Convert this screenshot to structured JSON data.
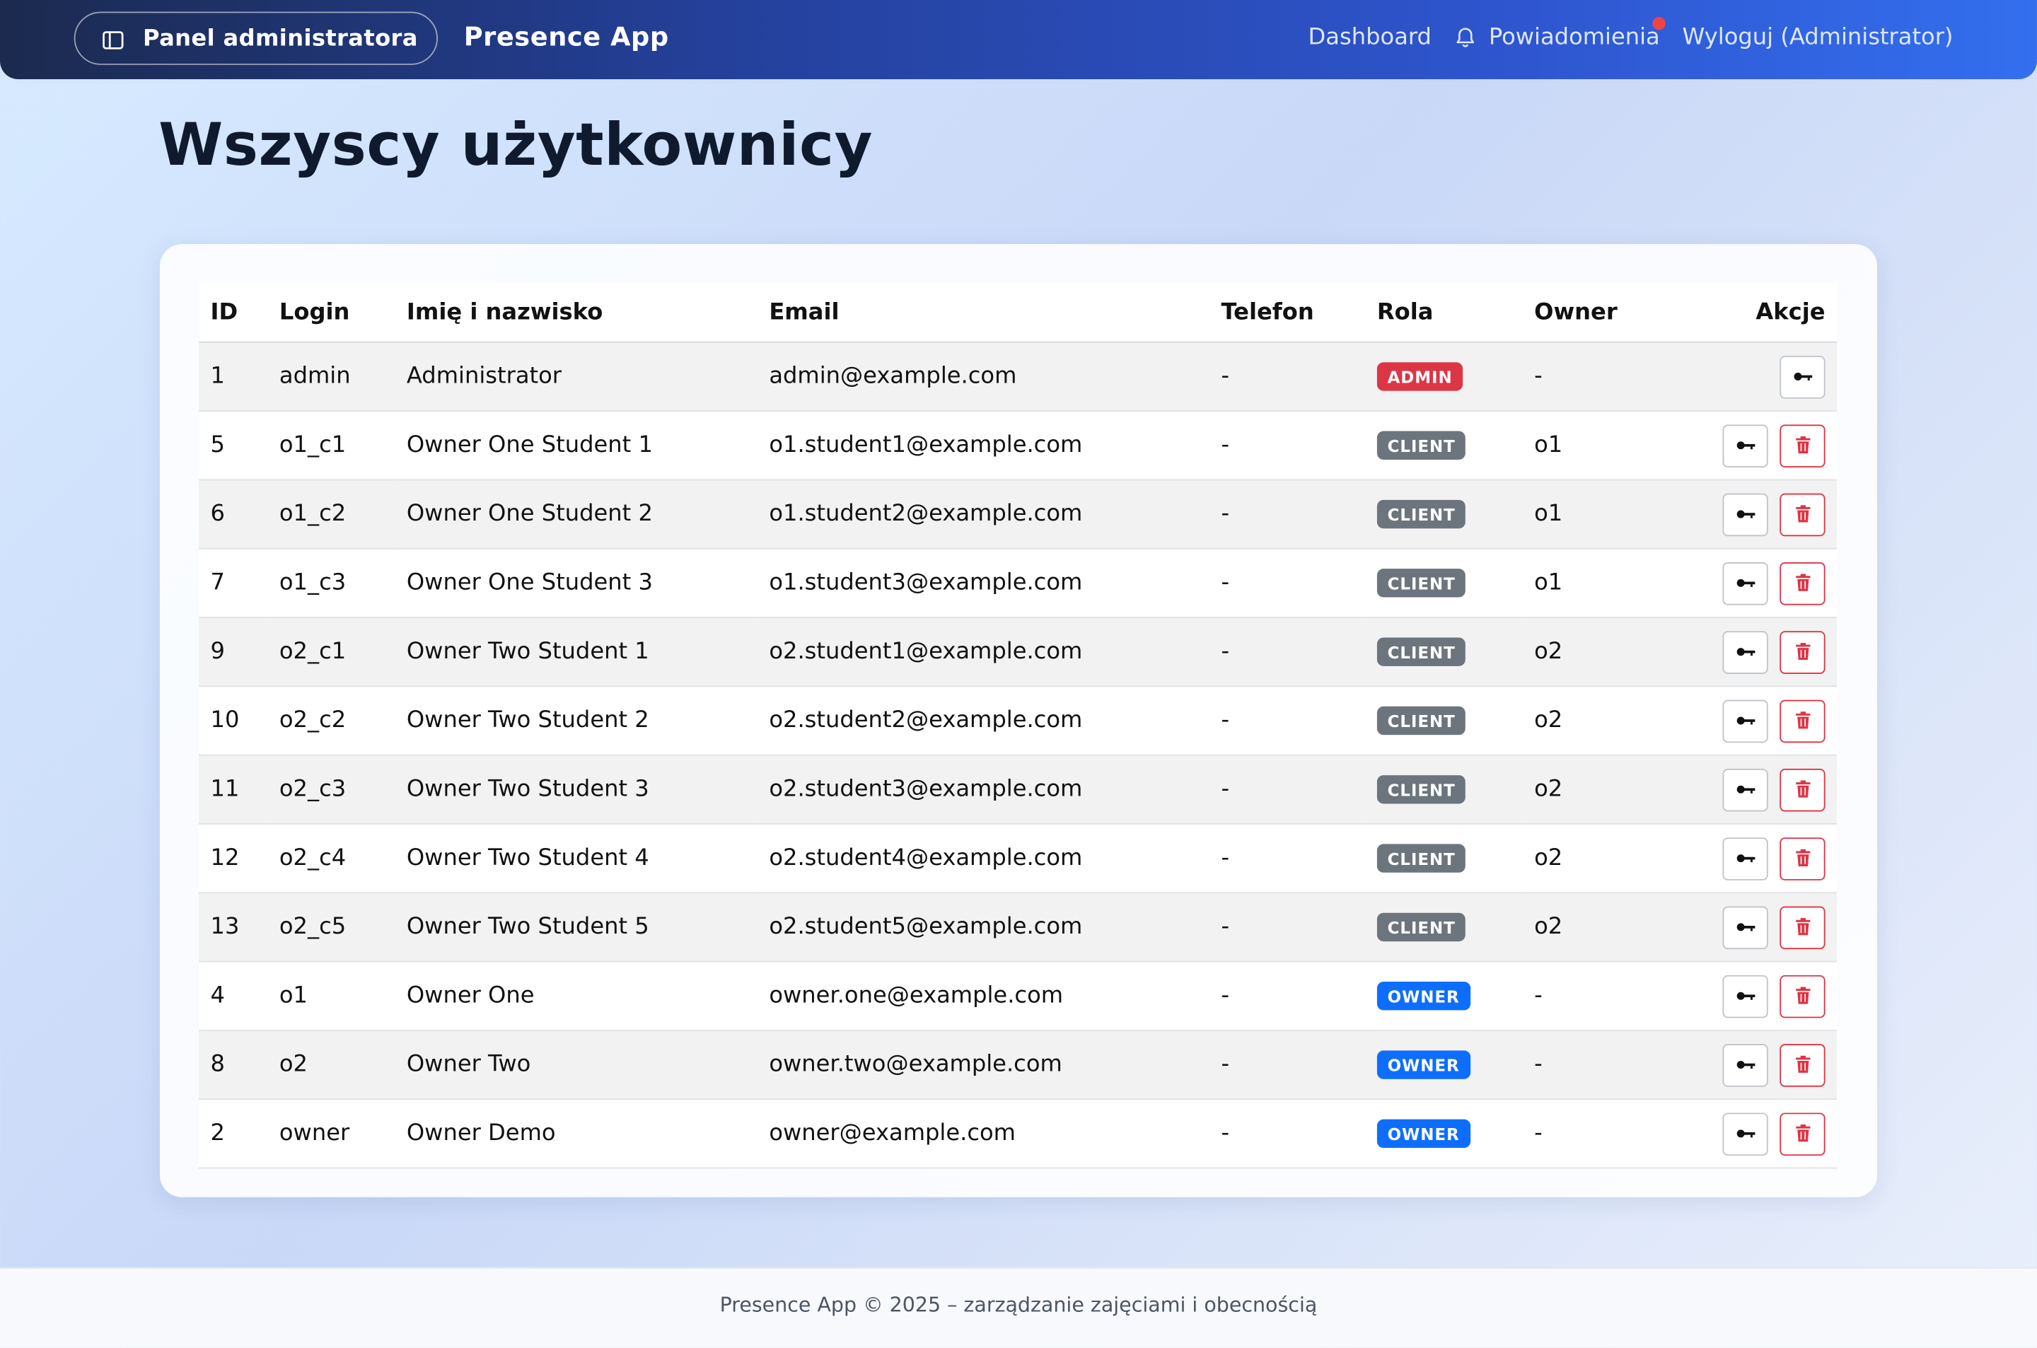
{
  "app": {
    "brand": "Presence App"
  },
  "topbar": {
    "panel_label": "Panel administratora",
    "nav": {
      "dashboard": "Dashboard",
      "notifications": "Powiadomienia",
      "logout": "Wyloguj (Administrator)"
    }
  },
  "page": {
    "title": "Wszyscy użytkownicy"
  },
  "table": {
    "headers": {
      "id": "ID",
      "login": "Login",
      "name": "Imię i nazwisko",
      "email": "Email",
      "phone": "Telefon",
      "role": "Rola",
      "owner": "Owner",
      "actions": "Akcje"
    },
    "rows": [
      {
        "id": "1",
        "login": "admin",
        "name": "Administrator",
        "email": "admin@example.com",
        "phone": "-",
        "role": "ADMIN",
        "owner": "-",
        "deletable": false
      },
      {
        "id": "5",
        "login": "o1_c1",
        "name": "Owner One Student 1",
        "email": "o1.student1@example.com",
        "phone": "-",
        "role": "CLIENT",
        "owner": "o1",
        "deletable": true
      },
      {
        "id": "6",
        "login": "o1_c2",
        "name": "Owner One Student 2",
        "email": "o1.student2@example.com",
        "phone": "-",
        "role": "CLIENT",
        "owner": "o1",
        "deletable": true
      },
      {
        "id": "7",
        "login": "o1_c3",
        "name": "Owner One Student 3",
        "email": "o1.student3@example.com",
        "phone": "-",
        "role": "CLIENT",
        "owner": "o1",
        "deletable": true
      },
      {
        "id": "9",
        "login": "o2_c1",
        "name": "Owner Two Student 1",
        "email": "o2.student1@example.com",
        "phone": "-",
        "role": "CLIENT",
        "owner": "o2",
        "deletable": true
      },
      {
        "id": "10",
        "login": "o2_c2",
        "name": "Owner Two Student 2",
        "email": "o2.student2@example.com",
        "phone": "-",
        "role": "CLIENT",
        "owner": "o2",
        "deletable": true
      },
      {
        "id": "11",
        "login": "o2_c3",
        "name": "Owner Two Student 3",
        "email": "o2.student3@example.com",
        "phone": "-",
        "role": "CLIENT",
        "owner": "o2",
        "deletable": true
      },
      {
        "id": "12",
        "login": "o2_c4",
        "name": "Owner Two Student 4",
        "email": "o2.student4@example.com",
        "phone": "-",
        "role": "CLIENT",
        "owner": "o2",
        "deletable": true
      },
      {
        "id": "13",
        "login": "o2_c5",
        "name": "Owner Two Student 5",
        "email": "o2.student5@example.com",
        "phone": "-",
        "role": "CLIENT",
        "owner": "o2",
        "deletable": true
      },
      {
        "id": "4",
        "login": "o1",
        "name": "Owner One",
        "email": "owner.one@example.com",
        "phone": "-",
        "role": "OWNER",
        "owner": "-",
        "deletable": true
      },
      {
        "id": "8",
        "login": "o2",
        "name": "Owner Two",
        "email": "owner.two@example.com",
        "phone": "-",
        "role": "OWNER",
        "owner": "-",
        "deletable": true
      },
      {
        "id": "2",
        "login": "owner",
        "name": "Owner Demo",
        "email": "owner@example.com",
        "phone": "-",
        "role": "OWNER",
        "owner": "-",
        "deletable": true
      }
    ]
  },
  "role_colors": {
    "ADMIN": "#dc3545",
    "CLIENT": "#6c757d",
    "OWNER": "#0d6efd"
  },
  "icons": {
    "panel": "sidebar-icon",
    "notifications": "bell-icon",
    "reset_password": "key-icon",
    "delete": "trash-icon"
  },
  "footer": {
    "text": "Presence App © 2025 – zarządzanie zajęciami i obecnością"
  }
}
